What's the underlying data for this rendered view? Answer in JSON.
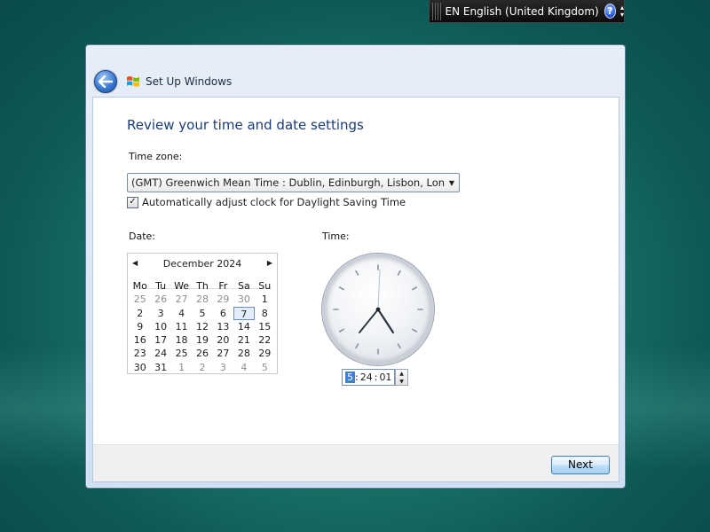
{
  "language_bar": {
    "label": "EN English (United Kingdom)",
    "help": "?"
  },
  "window": {
    "title": "Set Up Windows"
  },
  "page": {
    "heading": "Review your time and date settings",
    "timezone_label": "Time zone:",
    "timezone_value": "(GMT) Greenwich Mean Time : Dublin, Edinburgh, Lisbon, London",
    "dst_label": "Automatically adjust clock for Daylight Saving Time",
    "dst_checked": true,
    "date_label": "Date:",
    "time_label": "Time:"
  },
  "calendar": {
    "month": "December 2024",
    "weekdays": [
      "Mo",
      "Tu",
      "We",
      "Th",
      "Fr",
      "Sa",
      "Su"
    ],
    "weeks": [
      [
        "25",
        "26",
        "27",
        "28",
        "29",
        "30",
        "1"
      ],
      [
        "2",
        "3",
        "4",
        "5",
        "6",
        "7",
        "8"
      ],
      [
        "9",
        "10",
        "11",
        "12",
        "13",
        "14",
        "15"
      ],
      [
        "16",
        "17",
        "18",
        "19",
        "20",
        "21",
        "22"
      ],
      [
        "23",
        "24",
        "25",
        "26",
        "27",
        "28",
        "29"
      ],
      [
        "30",
        "31",
        "1",
        "2",
        "3",
        "4",
        "5"
      ]
    ],
    "selected_day": "7"
  },
  "time": {
    "hour": "5",
    "minute": "24",
    "second": "01",
    "sep": ":"
  },
  "footer": {
    "next_label": "Next"
  },
  "colors": {
    "heading": "#1a3c78",
    "selection": "#3c7fd6"
  }
}
